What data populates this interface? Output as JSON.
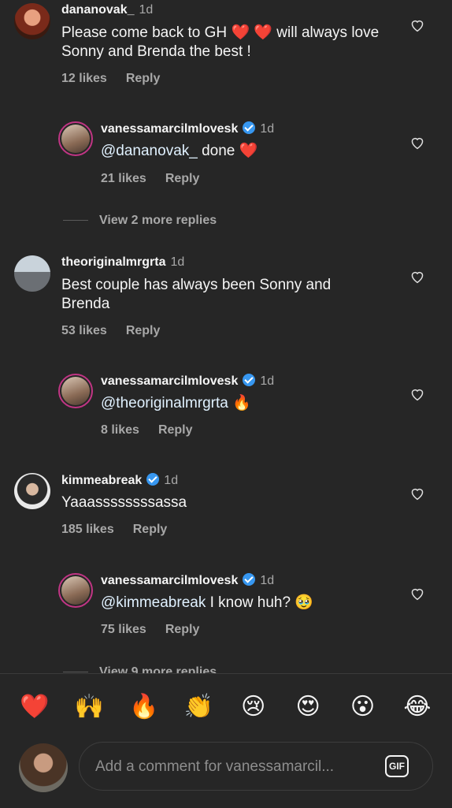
{
  "comments": [
    {
      "username": "dananovak_",
      "time": "1d",
      "text_parts": [
        "Please come back to GH ",
        "❤️ ❤️",
        " will always love Sonny and Brenda the best !"
      ],
      "likes": "12 likes",
      "reply": "Reply",
      "replies": [
        {
          "username": "vanessamarcilmlovesk",
          "time": "1d",
          "mention": "@dananovak_",
          "text": " done ❤️",
          "likes": "21 likes",
          "reply": "Reply"
        }
      ],
      "view_more": "View 2 more replies"
    },
    {
      "username": "theoriginalmrgrta",
      "time": "1d",
      "text": "Best couple has always been Sonny and Brenda",
      "likes": "53 likes",
      "reply": "Reply",
      "replies": [
        {
          "username": "vanessamarcilmlovesk",
          "time": "1d",
          "mention": "@theoriginalmrgrta",
          "text": " 🔥",
          "likes": "8 likes",
          "reply": "Reply"
        }
      ]
    },
    {
      "username": "kimmeabreak",
      "time": "1d",
      "text": "Yaaassssssssassa",
      "likes": "185 likes",
      "reply": "Reply",
      "replies": [
        {
          "username": "vanessamarcilmlovesk",
          "time": "1d",
          "mention": "@kimmeabreak",
          "text": " I know huh? 🥹",
          "likes": "75 likes",
          "reply": "Reply"
        }
      ],
      "view_more": "View 9 more replies"
    }
  ],
  "emoji_bar": [
    "❤️",
    "🙌",
    "🔥",
    "👏",
    "😢",
    "😍",
    "😮",
    "😂"
  ],
  "composer": {
    "placeholder": "Add a comment for vanessamarcil...",
    "gif_label": "GIF"
  },
  "colors": {
    "background": "#262626",
    "verified": "#3797f0",
    "story_ring": "#c13584"
  }
}
